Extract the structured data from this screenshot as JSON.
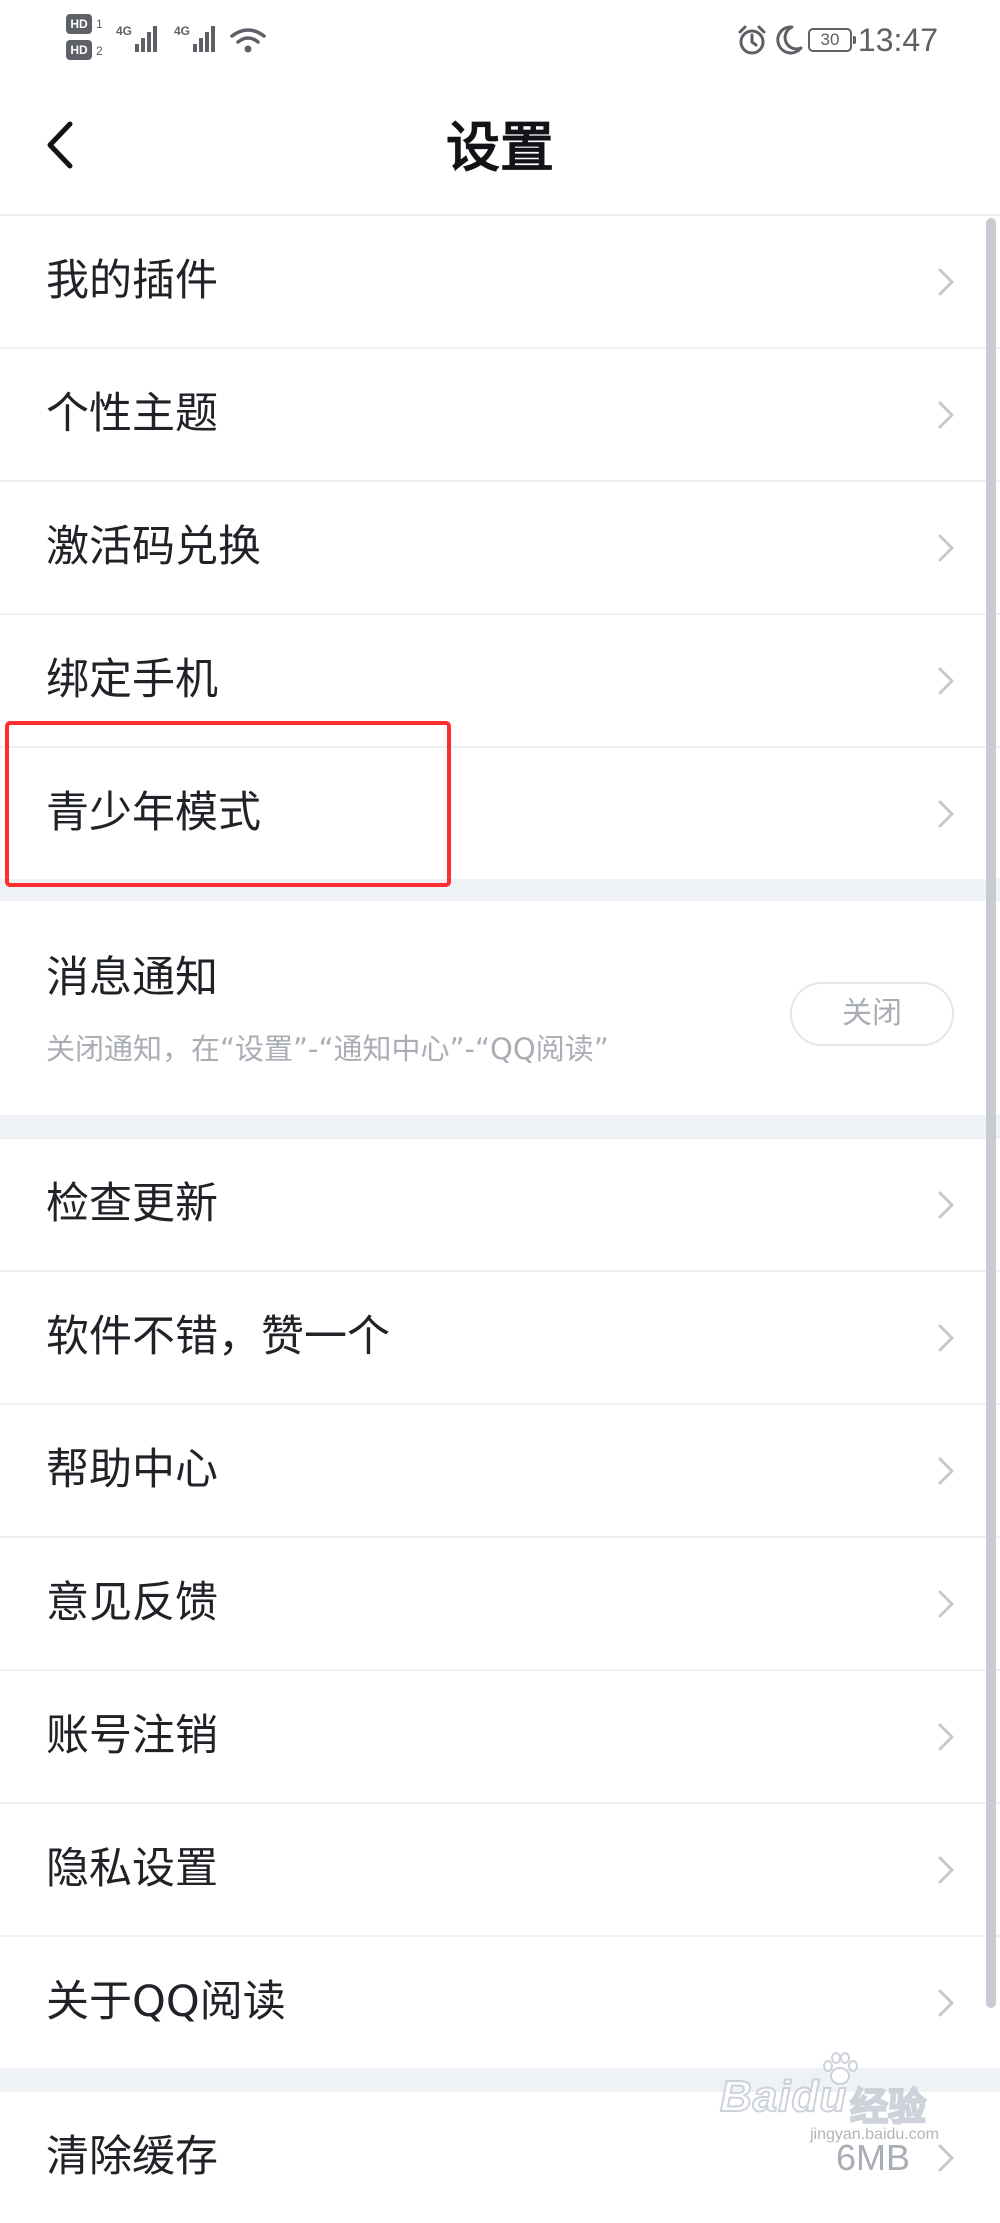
{
  "status_bar": {
    "sim1": "1",
    "sim2": "2",
    "hd_label": "HD",
    "network_1": "4G",
    "network_2": "4G",
    "battery": "30",
    "time": "13:47",
    "icons": [
      "alarm-icon",
      "moon-icon",
      "wifi-icon",
      "signal-icon"
    ]
  },
  "header": {
    "title": "设置",
    "back_icon": "chevron-left-icon"
  },
  "groups": [
    {
      "items": [
        {
          "label": "我的插件"
        },
        {
          "label": "个性主题"
        },
        {
          "label": "激活码兑换"
        },
        {
          "label": "绑定手机"
        },
        {
          "label": "青少年模式"
        }
      ]
    },
    {
      "notification": {
        "title": "消息通知",
        "description": "关闭通知，在“设置”-“通知中心”-“QQ阅读”",
        "button": "关闭"
      }
    },
    {
      "items": [
        {
          "label": "检查更新"
        },
        {
          "label": "软件不错，赞一个"
        },
        {
          "label": "帮助中心"
        },
        {
          "label": "意见反馈"
        },
        {
          "label": "账号注销"
        },
        {
          "label": "隐私设置"
        },
        {
          "label": "关于QQ阅读"
        }
      ]
    },
    {
      "items": [
        {
          "label": "清除缓存",
          "value": "6MB"
        }
      ]
    }
  ],
  "watermark": {
    "brand": "Baidu",
    "cn": "经验",
    "url": "jingyan.baidu.com"
  },
  "colors": {
    "highlight": "#ff2d2d",
    "background": "#f3f5f8",
    "text": "#1f2227",
    "muted": "#a9adb4"
  }
}
